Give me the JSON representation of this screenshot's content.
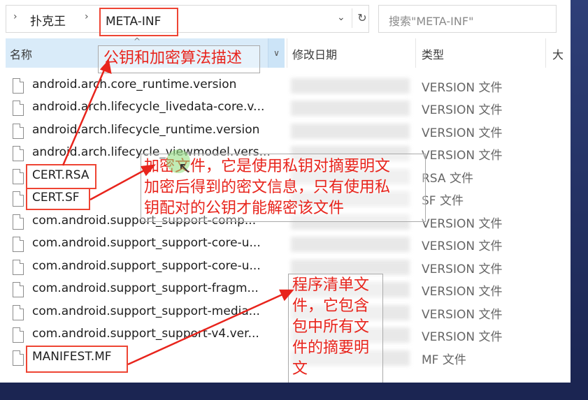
{
  "address": {
    "crumb_root": "扑克王",
    "current": "META-INF",
    "back_arrow": "›",
    "sep_arrow": "›",
    "dropdown_icon": "chevron-down-icon",
    "refresh_icon": "refresh-icon"
  },
  "search": {
    "placeholder": "搜索\"META-INF\""
  },
  "columns": {
    "name": "名称",
    "date": "修改日期",
    "type": "类型",
    "extra": "大"
  },
  "files": [
    {
      "name": "android.arch.core_runtime.version",
      "type": "VERSION 文件"
    },
    {
      "name": "android.arch.lifecycle_livedata-core.v...",
      "type": "VERSION 文件"
    },
    {
      "name": "android.arch.lifecycle_runtime.version",
      "type": "VERSION 文件"
    },
    {
      "name": "android.arch.lifecycle_viewmodel.vers...",
      "type": "VERSION 文件"
    },
    {
      "name": "CERT.RSA",
      "type": "RSA 文件"
    },
    {
      "name": "CERT.SF",
      "type": "SF 文件"
    },
    {
      "name": "com.android.support_support-comp...",
      "type": "VERSION 文件"
    },
    {
      "name": "com.android.support_support-core-u...",
      "type": "VERSION 文件"
    },
    {
      "name": "com.android.support_support-core-u...",
      "type": "VERSION 文件"
    },
    {
      "name": "com.android.support_support-fragm...",
      "type": "VERSION 文件"
    },
    {
      "name": "com.android.support_support-media...",
      "type": "VERSION 文件"
    },
    {
      "name": "com.android.support_support-v4.ver...",
      "type": "VERSION 文件"
    },
    {
      "name": "MANIFEST.MF",
      "type": "MF 文件"
    }
  ],
  "annotations": {
    "sf": "公钥和加密算法描述",
    "rsa_1": "加密文件，它是使用私钥对摘要明文",
    "rsa_2": "加密后得到的密文信息，只有使用私",
    "rsa_3": "钥配对的公钥才能解密该文件",
    "mf_1": "程序清单文",
    "mf_2": "件，它包含",
    "mf_3": "包中所有文",
    "mf_4": "件的摘要明",
    "mf_5": "文"
  },
  "colors": {
    "annotation": "#e8241c",
    "header_selected": "#d9ebf9",
    "background": "#1b2a57"
  }
}
